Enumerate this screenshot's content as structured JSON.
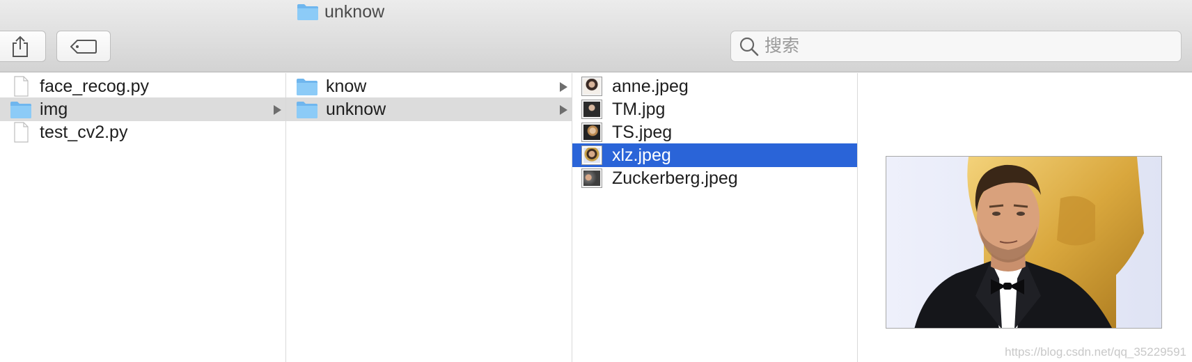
{
  "window": {
    "title": "unknow",
    "title_icon": "folder-icon"
  },
  "toolbar": {
    "share_icon": "share-icon",
    "tag_icon": "tag-icon",
    "search": {
      "placeholder": "搜索",
      "icon": "search-icon"
    }
  },
  "columns": [
    {
      "items": [
        {
          "label": "face_recog.py",
          "type": "file",
          "selected": false
        },
        {
          "label": "img",
          "type": "folder",
          "selected": true
        },
        {
          "label": "test_cv2.py",
          "type": "file",
          "selected": false
        }
      ]
    },
    {
      "items": [
        {
          "label": "know",
          "type": "folder",
          "selected": false
        },
        {
          "label": "unknow",
          "type": "folder",
          "selected": true
        }
      ]
    },
    {
      "items": [
        {
          "label": "anne.jpeg",
          "type": "image",
          "selected": false
        },
        {
          "label": "TM.jpg",
          "type": "image",
          "selected": false
        },
        {
          "label": "TS.jpeg",
          "type": "image",
          "selected": false
        },
        {
          "label": "xlz.jpeg",
          "type": "image",
          "selected": true
        },
        {
          "label": "Zuckerberg.jpeg",
          "type": "image",
          "selected": false
        }
      ]
    }
  ],
  "preview": {
    "file": "xlz.jpeg"
  },
  "watermark": "https://blog.csdn.net/qq_35229591",
  "colors": {
    "selection_blue": "#2a64d8",
    "selection_gray": "#dcdcdc",
    "folder_blue": "#7cc0f2"
  }
}
